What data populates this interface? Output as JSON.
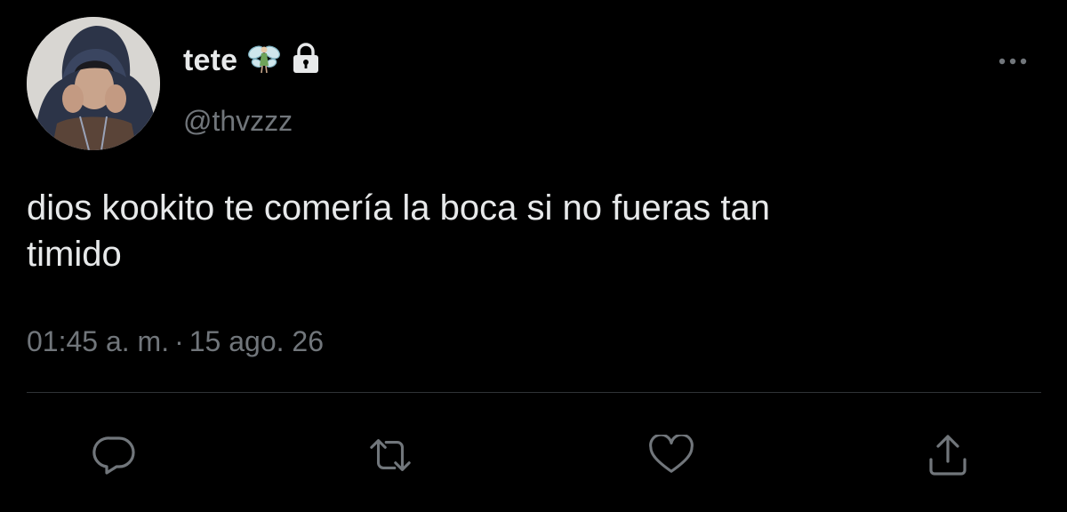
{
  "author": {
    "display_name": "tete",
    "handle": "@thvzzz",
    "badges": [
      "fairy-icon",
      "lock-icon"
    ]
  },
  "tweet": {
    "text": "dios kookito te comería la boca si no fueras tan\ntimido",
    "time": "01:45 a. m.",
    "separator": "·",
    "date": "15 ago. 26"
  },
  "actions": [
    "reply-icon",
    "retweet-icon",
    "like-icon",
    "share-icon"
  ],
  "colors": {
    "background": "#000000",
    "text": "#e7e9ea",
    "secondary_text": "#71767b",
    "divider": "#2f3336"
  }
}
